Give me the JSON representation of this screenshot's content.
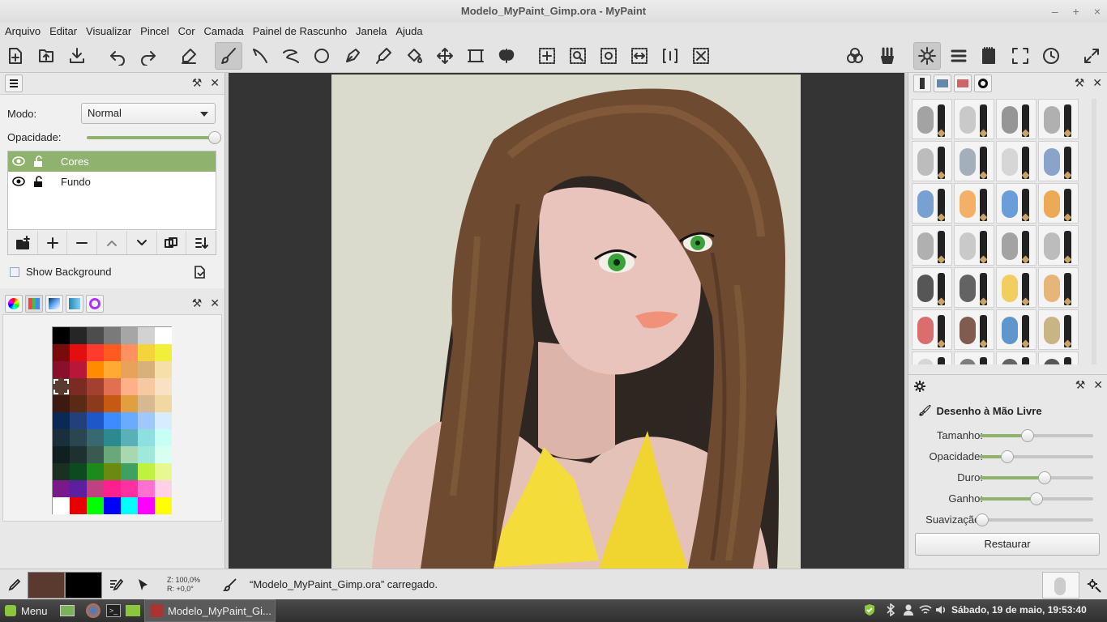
{
  "window": {
    "title": "Modelo_MyPaint_Gimp.ora - MyPaint",
    "controls": [
      "–",
      "+",
      "×"
    ]
  },
  "menu": [
    "Arquivo",
    "Editar",
    "Visualizar",
    "Pincel",
    "Cor",
    "Camada",
    "Painel de Rascunho",
    "Janela",
    "Ajuda"
  ],
  "toolbar": {
    "tools": [
      "new-document",
      "open-document",
      "save-document",
      "undo",
      "redo",
      "eraser",
      "freehand-brush",
      "inking",
      "lasso-line",
      "ellipse",
      "bezier-pen",
      "color-picker",
      "fill-bucket",
      "move-layer",
      "crop-frame",
      "symmetry",
      "pan-view",
      "zoom-view",
      "rotate-view",
      "mirror-horizontal",
      "fit-frame",
      "reset-view",
      "layer-blend",
      "brush-groups",
      "preferences",
      "menu",
      "scratchpad",
      "fullscreen",
      "history"
    ],
    "active_tool": "freehand-brush",
    "active_right": "preferences"
  },
  "layers_panel": {
    "mode_label": "Modo:",
    "mode_value": "Normal",
    "opacity_label": "Opacidade:",
    "opacity_value": 1.0,
    "layers": [
      {
        "name": "Cores",
        "selected": true
      },
      {
        "name": "Fundo",
        "selected": false
      }
    ],
    "show_background_label": "Show Background",
    "show_background": false
  },
  "palette": {
    "selected_index": 21,
    "colors": [
      "#000000",
      "#262626",
      "#4d4d4d",
      "#7a7a7a",
      "#a6a6a6",
      "#d2d2d2",
      "#ffffff",
      "#7a0b0b",
      "#e30e0e",
      "#ff3b2e",
      "#ff5a20",
      "#ff9060",
      "#f5d33a",
      "#f0f03a",
      "#8a0f2a",
      "#b8173a",
      "#ff8c00",
      "#ffaa33",
      "#e8a25a",
      "#d8b07a",
      "#f4e0a8",
      "#5a3a2e",
      "#7a2c22",
      "#a44030",
      "#e07050",
      "#ffb088",
      "#f8c8a0",
      "#f8e2c4",
      "#3c1a12",
      "#5a2a14",
      "#8b3a1e",
      "#c65a12",
      "#e0a040",
      "#d8b890",
      "#f0d8a0",
      "#0a2a55",
      "#23407a",
      "#1e58c8",
      "#3c8cff",
      "#6aaaff",
      "#a0c8ff",
      "#d8ecff",
      "#1a2e3c",
      "#2a4650",
      "#3a6870",
      "#2a8a90",
      "#5ab0b8",
      "#8ee0e0",
      "#c8fff4",
      "#102020",
      "#1e3030",
      "#3a5a50",
      "#6aa87a",
      "#a8d8b0",
      "#a0e8d8",
      "#d8fff0",
      "#1a3020",
      "#0c4a20",
      "#1e8a1e",
      "#6a8a10",
      "#40a060",
      "#c0f040",
      "#e8f890",
      "#7a1a8a",
      "#5a20a0",
      "#c04080",
      "#ff2090",
      "#ff30a0",
      "#ff70d0",
      "#ffd0e8",
      "#ffffff",
      "#e80000",
      "#00ff00",
      "#0000ff",
      "#00ffff",
      "#ff00ff",
      "#ffff00"
    ]
  },
  "brushes": {
    "stroke_colors": [
      "#888888",
      "#bbbbbb",
      "#777777",
      "#999999",
      "#aaaaaa",
      "#8899aa",
      "#cccccc",
      "#6688bb",
      "#4f86c6",
      "#f59a3a",
      "#3c82d0",
      "#e8921e",
      "#999999",
      "#bbbbbb",
      "#888888",
      "#aaaaaa",
      "#222222",
      "#333333",
      "#f2c230",
      "#e0a050",
      "#d24040",
      "#5a2a1a",
      "#2e78c0",
      "#b8a060",
      "#cccccc",
      "#555555",
      "#333333",
      "#222222"
    ]
  },
  "brush_settings": {
    "title": "Desenho à Mão Livre",
    "settings": [
      {
        "label": "Tamanho:",
        "value": 0.42
      },
      {
        "label": "Opacidade:",
        "value": 0.24
      },
      {
        "label": "Duro:",
        "value": 0.57
      },
      {
        "label": "Ganho:",
        "value": 0.5
      },
      {
        "label": "Suavização:",
        "value": 0.02
      }
    ],
    "restore_label": "Restaurar"
  },
  "status": {
    "zoom": "Z: 100,0%",
    "rotation": "R: +0,0°",
    "message": "“Modelo_MyPaint_Gimp.ora” carregado.",
    "fg_color": "#5a3a2e",
    "bg_color": "#000000"
  },
  "taskbar": {
    "menu_label": "Menu",
    "window_label": "Modelo_MyPaint_Gi...",
    "clock": "Sábado, 19 de maio, 19:53:40"
  }
}
